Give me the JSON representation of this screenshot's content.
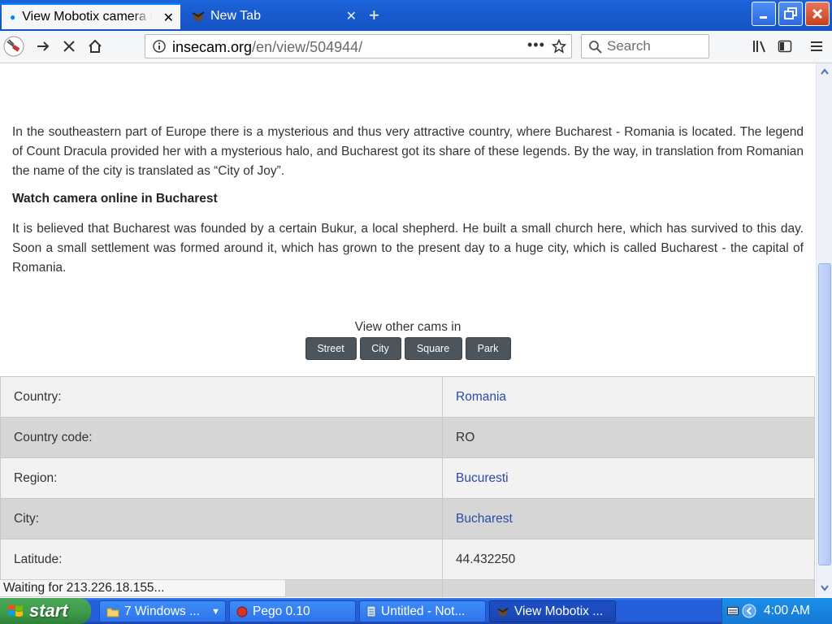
{
  "browser": {
    "tabs": [
      {
        "title": "View Mobotix camera in",
        "active": true
      },
      {
        "title": "New Tab",
        "active": false
      }
    ],
    "url": {
      "host": "insecam.org",
      "path": "/en/view/504944/"
    },
    "search_placeholder": "Search"
  },
  "page": {
    "paragraph1": "In the southeastern part of Europe there is a mysterious and thus very attractive country, where Bucharest - Romania is located. The legend of Count Dracula provided her with a mysterious halo, and Bucharest got its share of these legends. By the way, in translation from Romanian the name of the city is translated as “City of Joy”.",
    "subheading": "Watch camera online in Bucharest",
    "paragraph2": "It is believed that Bucharest was founded by a certain Bukur, a local shepherd. He built a small church here, which has survived to this day. Soon a small settlement was formed around it, which has grown to the present day to a huge city, which is called Bucharest - the capital of Romania.",
    "view_other_label": "View other cams in",
    "tag_buttons": [
      "Street",
      "City",
      "Square",
      "Park"
    ],
    "info_rows": [
      {
        "key": "Country:",
        "value": "Romania",
        "link": true
      },
      {
        "key": "Country code:",
        "value": "RO",
        "link": false
      },
      {
        "key": "Region:",
        "value": "Bucuresti",
        "link": true
      },
      {
        "key": "City:",
        "value": "Bucharest",
        "link": true
      },
      {
        "key": "Latitude:",
        "value": "44.432250",
        "link": false
      }
    ]
  },
  "status": "Waiting for 213.226.18.155...",
  "taskbar": {
    "start_label": "start",
    "items": [
      {
        "label": "7 Windows ...",
        "icon": "folder-icon"
      },
      {
        "label": "Pego 0.10",
        "icon": "pego-icon"
      },
      {
        "label": "Untitled - Not...",
        "icon": "notepad-icon"
      },
      {
        "label": "View Mobotix ...",
        "icon": "firefox-icon"
      }
    ],
    "clock": "4:00 AM"
  },
  "colors": {
    "titlebar": "#1c63d9",
    "link": "#2c4aa8",
    "tag_button": "#4d555c",
    "row_light": "#f2f2f2",
    "row_dark": "#d6d6d6",
    "taskbar": "#245edb",
    "start_button": "#3c9a48"
  }
}
